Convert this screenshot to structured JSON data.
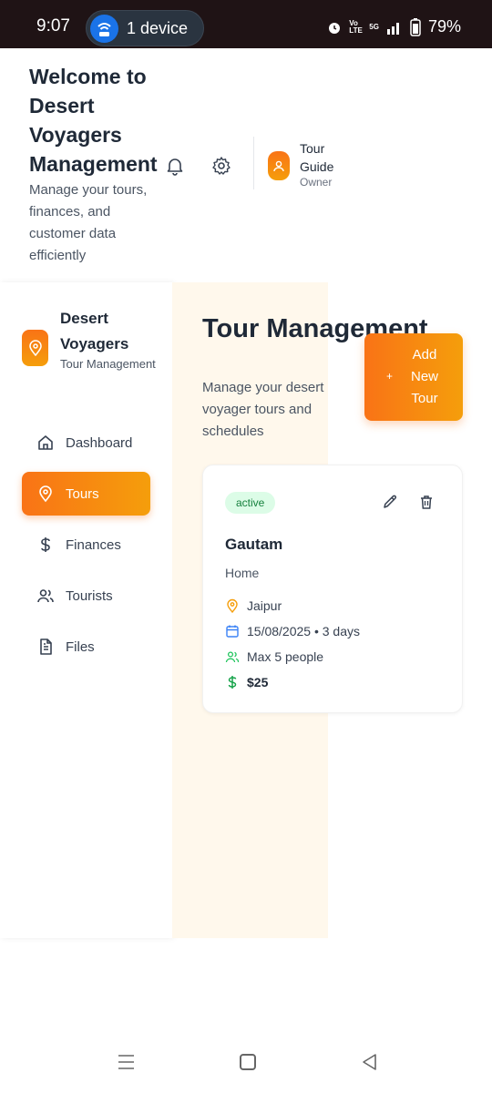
{
  "status_bar": {
    "time": "9:07",
    "device_pill": "1 device",
    "network": "5G",
    "volte": "Vo LTE",
    "battery": "79%"
  },
  "header": {
    "title": "Welcome to Desert Voyagers Management",
    "subtitle": "Manage your tours, finances, and customer data efficiently",
    "user_name": "Tour Guide",
    "user_role": "Owner"
  },
  "sidebar": {
    "brand": "Desert Voyagers",
    "brand_sub": "Tour Management",
    "items": [
      {
        "label": "Dashboard",
        "icon": "home-icon",
        "active": false
      },
      {
        "label": "Tours",
        "icon": "map-pin-icon",
        "active": true
      },
      {
        "label": "Finances",
        "icon": "dollar-icon",
        "active": false
      },
      {
        "label": "Tourists",
        "icon": "users-icon",
        "active": false
      },
      {
        "label": "Files",
        "icon": "file-icon",
        "active": false
      }
    ]
  },
  "main": {
    "title": "Tour Management",
    "subtitle": "Manage your desert voyager tours and schedules",
    "add_button": "Add New Tour",
    "add_plus": "+"
  },
  "tour_card": {
    "status": "active",
    "name": "Gautam",
    "type": "Home",
    "location": "Jaipur",
    "date": "15/08/2025 • 3 days",
    "capacity": "Max 5 people",
    "price": "$25"
  },
  "colors": {
    "accent_start": "#f97316",
    "accent_end": "#f59e0b",
    "status_green_bg": "#dcfce7",
    "status_green_text": "#15803d"
  }
}
